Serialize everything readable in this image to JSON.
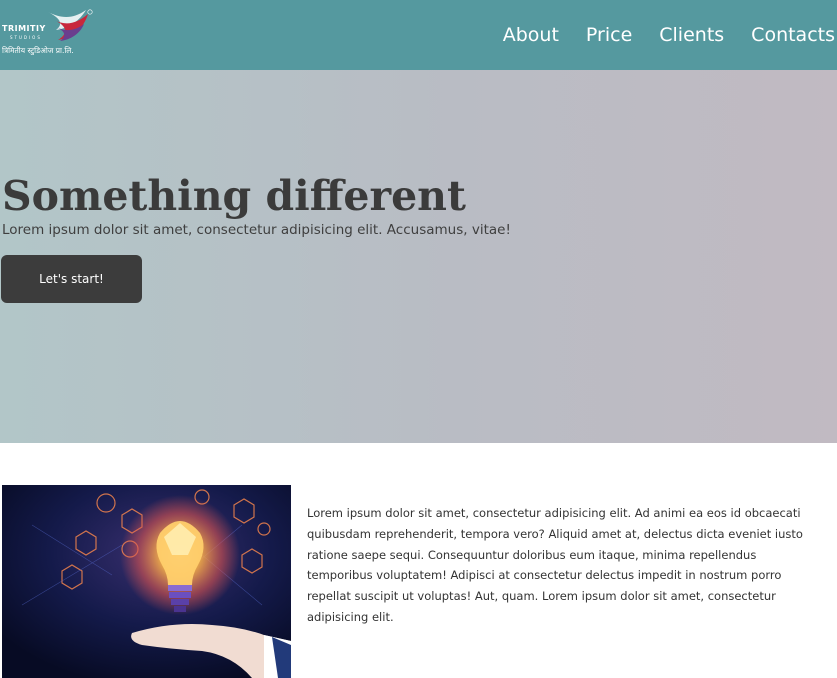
{
  "header": {
    "logo": {
      "name": "TRIMITIY",
      "sub": "STUDIOS",
      "hindi": "त्रिमितीय स्टुडिओज प्रा.लि.",
      "registered": "®"
    },
    "nav": [
      {
        "label": "About"
      },
      {
        "label": "Price"
      },
      {
        "label": "Clients"
      },
      {
        "label": "Contacts"
      }
    ]
  },
  "hero": {
    "title": "Something different",
    "subtitle": "Lorem ipsum dolor sit amet, consectetur adipisicing elit. Accusamus, vitae!",
    "cta_label": "Let's start!"
  },
  "content": {
    "paragraph": "Lorem ipsum dolor sit amet, consectetur adipisicing elit. Ad animi ea eos id obcaecati quibusdam reprehenderit, tempora vero? Aliquid amet at, delectus dicta eveniet iusto ratione saepe sequi. Consequuntur doloribus eum itaque, minima repellendus temporibus voluptatem! Adipisci at consectetur delectus impedit in nostrum porro repellat suscipit ut voluptas! Aut, quam. Lorem ipsum dolor sit amet, consectetur adipisicing elit.",
    "image_icon": "lightbulb-in-hand-icon"
  },
  "colors": {
    "header_bg": "#55999f",
    "hero_gradient_start": "#b2c6c8",
    "hero_gradient_end": "#c1bac2",
    "button_bg": "#3c3c3c",
    "logo_accent_red": "#c8283c",
    "logo_accent_purple": "#6a3e8e"
  }
}
